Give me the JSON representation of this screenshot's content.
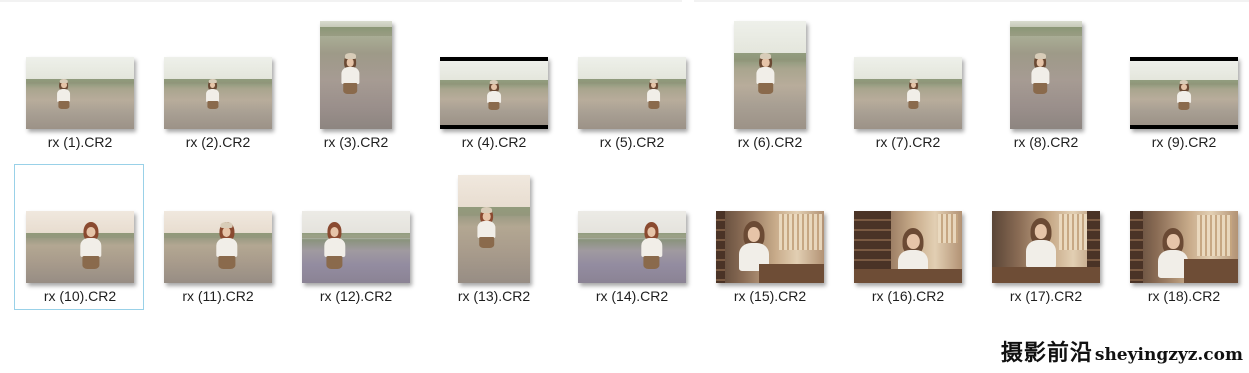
{
  "files": [
    {
      "name": "rx (1).CR2",
      "orientation": "landscape",
      "scene": "meadow"
    },
    {
      "name": "rx (2).CR2",
      "orientation": "landscape",
      "scene": "meadow"
    },
    {
      "name": "rx (3).CR2",
      "orientation": "portrait",
      "scene": "meadow-dense"
    },
    {
      "name": "rx (4).CR2",
      "orientation": "landscape",
      "scene": "meadow-letterbox"
    },
    {
      "name": "rx (5).CR2",
      "orientation": "landscape",
      "scene": "meadow"
    },
    {
      "name": "rx (6).CR2",
      "orientation": "portrait",
      "scene": "meadow"
    },
    {
      "name": "rx (7).CR2",
      "orientation": "landscape",
      "scene": "meadow"
    },
    {
      "name": "rx (8).CR2",
      "orientation": "portrait",
      "scene": "meadow-dense"
    },
    {
      "name": "rx (9).CR2",
      "orientation": "landscape",
      "scene": "meadow-letterbox"
    },
    {
      "name": "rx (10).CR2",
      "orientation": "landscape",
      "scene": "meadow-warm",
      "selected": true
    },
    {
      "name": "rx (11).CR2",
      "orientation": "landscape",
      "scene": "meadow-warm"
    },
    {
      "name": "rx (12).CR2",
      "orientation": "landscape",
      "scene": "meadow-purple"
    },
    {
      "name": "rx (13).CR2",
      "orientation": "portrait",
      "scene": "meadow-warm"
    },
    {
      "name": "rx (14).CR2",
      "orientation": "landscape",
      "scene": "meadow-purple"
    },
    {
      "name": "rx (15).CR2",
      "orientation": "landscape",
      "scene": "indoor"
    },
    {
      "name": "rx (16).CR2",
      "orientation": "landscape",
      "scene": "indoor"
    },
    {
      "name": "rx (17).CR2",
      "orientation": "landscape",
      "scene": "indoor"
    },
    {
      "name": "rx (18).CR2",
      "orientation": "landscape",
      "scene": "indoor"
    }
  ],
  "watermark": {
    "chinese": "摄影前沿",
    "site": "sheyingzyz.com"
  },
  "colors": {
    "selection_border": "#99d1e8",
    "label_text": "#1e1e1e",
    "background": "#ffffff"
  }
}
